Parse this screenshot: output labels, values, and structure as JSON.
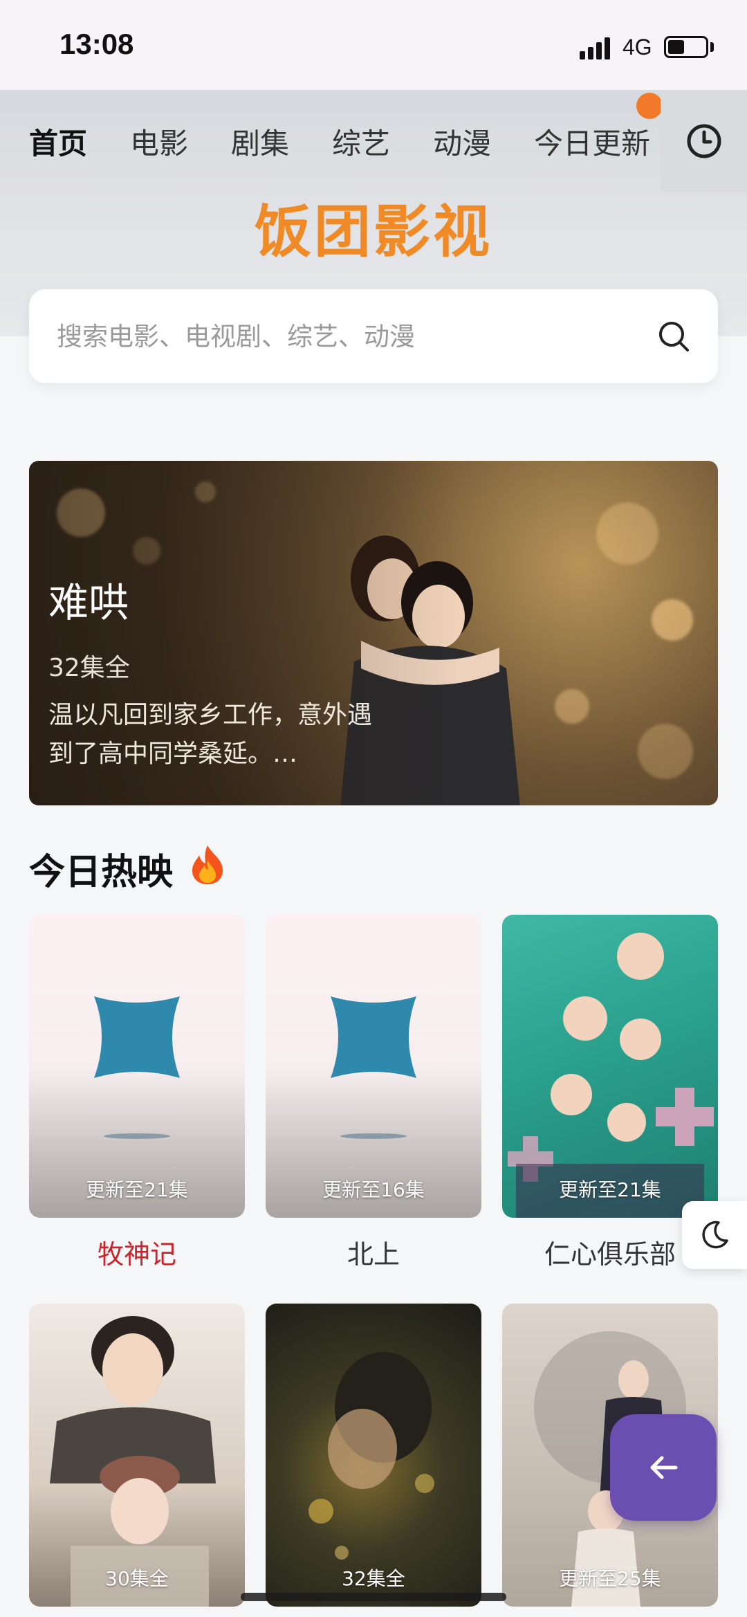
{
  "status_bar": {
    "time": "13:08",
    "network": "4G",
    "battery_percent": 45
  },
  "nav": {
    "tabs": [
      {
        "label": "首页",
        "active": true
      },
      {
        "label": "电影"
      },
      {
        "label": "剧集"
      },
      {
        "label": "综艺"
      },
      {
        "label": "动漫"
      },
      {
        "label": "今日更新",
        "has_badge": true
      }
    ],
    "history_icon": "clock-icon"
  },
  "logo_text": "饭团影视",
  "search": {
    "placeholder": "搜索电影、电视剧、综艺、动漫",
    "icon": "search-icon"
  },
  "banner": {
    "title": "难哄",
    "episodes": "32集全",
    "description": "温以凡回到家乡工作，意外遇到了高中同学桑延。…"
  },
  "section": {
    "title": "今日热映",
    "icon": "fire-icon"
  },
  "cards": [
    {
      "title": "牧神记",
      "label": "更新至21集",
      "active": true
    },
    {
      "title": "北上",
      "label": "更新至16集"
    },
    {
      "title": "仁心俱乐部",
      "label": "更新至21集"
    },
    {
      "title": "",
      "label": "30集全"
    },
    {
      "title": "",
      "label": "32集全"
    },
    {
      "title": "",
      "label": "更新至25集"
    }
  ],
  "colors": {
    "accent": "#ef8a26",
    "active_title": "#c8242b",
    "fab": "#6a4fb0"
  },
  "buttons": {
    "night_mode_icon": "moon-icon",
    "back_icon": "arrow-left-icon"
  }
}
